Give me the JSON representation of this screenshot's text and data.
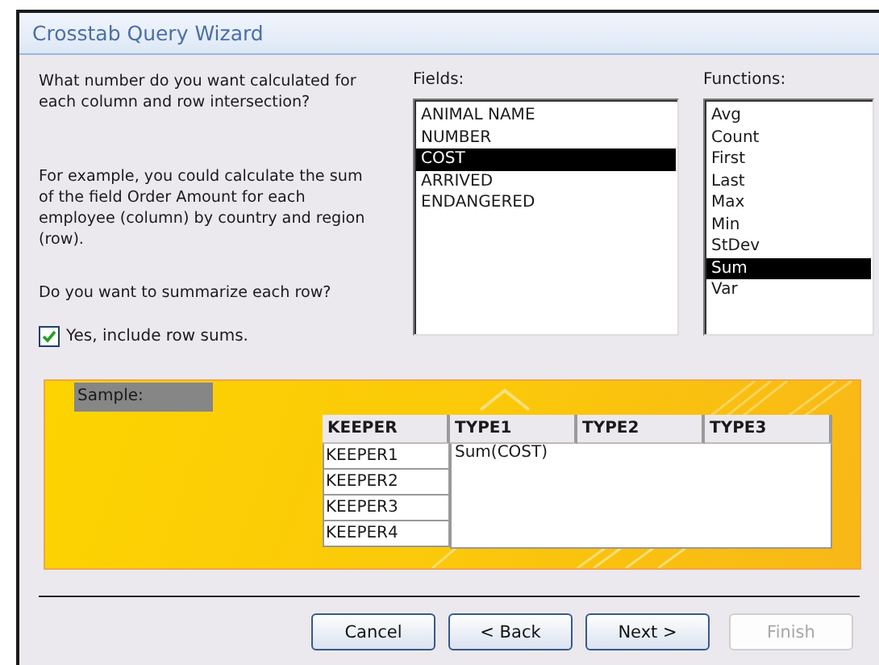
{
  "window": {
    "title": "Crosstab Query Wizard"
  },
  "prompt": "What number do you want calculated for each column and row intersection?",
  "example": "For example, you could calculate the sum of the field Order Amount for each employee (column)  by country and region (row).",
  "summarize_question": "Do you want to summarize each row?",
  "row_sums": {
    "label": "Yes, include row sums.",
    "checked": true
  },
  "fields": {
    "label": "Fields:",
    "items": [
      {
        "text": "ANIMAL NAME",
        "selected": false
      },
      {
        "text": "NUMBER",
        "selected": false
      },
      {
        "text": "COST",
        "selected": true
      },
      {
        "text": "ARRIVED",
        "selected": false
      },
      {
        "text": "ENDANGERED",
        "selected": false
      }
    ]
  },
  "functions": {
    "label": "Functions:",
    "items": [
      {
        "text": "Avg",
        "selected": false
      },
      {
        "text": "Count",
        "selected": false
      },
      {
        "text": "First",
        "selected": false
      },
      {
        "text": "Last",
        "selected": false
      },
      {
        "text": "Max",
        "selected": false
      },
      {
        "text": "Min",
        "selected": false
      },
      {
        "text": "StDev",
        "selected": false
      },
      {
        "text": "Sum",
        "selected": true
      },
      {
        "text": "Var",
        "selected": false
      }
    ]
  },
  "sample": {
    "label": "Sample:",
    "columns": [
      "KEEPER",
      "TYPE1",
      "TYPE2",
      "TYPE3"
    ],
    "rows": [
      "KEEPER1",
      "KEEPER2",
      "KEEPER3",
      "KEEPER4"
    ],
    "value": "Sum(COST)"
  },
  "buttons": [
    {
      "label": "Cancel",
      "disabled": false
    },
    {
      "label": "< Back",
      "disabled": false
    },
    {
      "label": "Next >",
      "disabled": false
    },
    {
      "label": "Finish",
      "disabled": true
    }
  ]
}
